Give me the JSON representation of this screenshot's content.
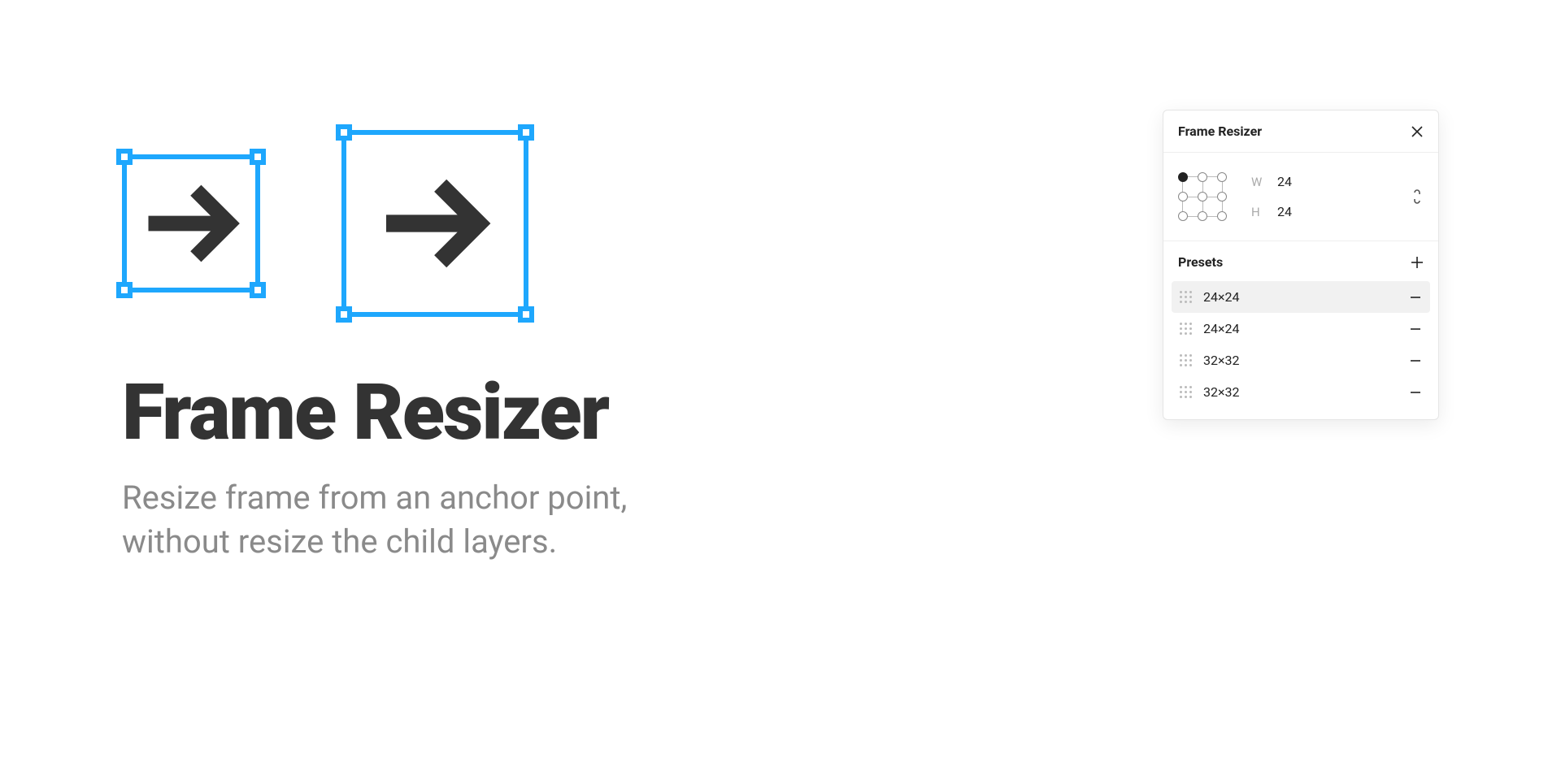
{
  "hero": {
    "title": "Frame Resizer",
    "subtitle": "Resize frame from an anchor point, without resize the child layers."
  },
  "panel": {
    "title": "Frame Resizer",
    "width_label": "W",
    "width_value": "24",
    "height_label": "H",
    "height_value": "24",
    "anchor_selected_index": 0,
    "link_aspect": false
  },
  "presets": {
    "title": "Presets",
    "items": [
      {
        "label": "24×24",
        "selected": true
      },
      {
        "label": "24×24",
        "selected": false
      },
      {
        "label": "32×32",
        "selected": false
      },
      {
        "label": "32×32",
        "selected": false
      }
    ]
  }
}
